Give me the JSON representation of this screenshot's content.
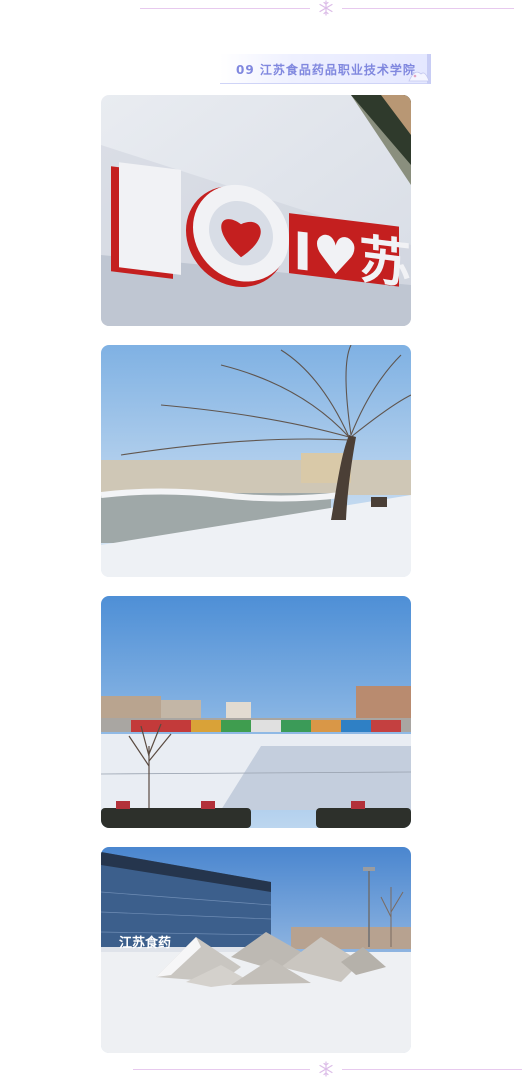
{
  "top_divider": {
    "icon": "snowflake-icon"
  },
  "section_label": {
    "text": "09 江苏食品药品职业技术学院",
    "decoration": "snow-landscape-icon",
    "accent_color": "#8088df"
  },
  "photos": [
    {
      "name": "photo-i-love-sign",
      "sign_text": "I♥苏食院"
    },
    {
      "name": "photo-willow-lake"
    },
    {
      "name": "photo-sports-field"
    },
    {
      "name": "photo-rock-garden",
      "sign_text": "江苏食药"
    }
  ],
  "bottom_divider": {
    "icon": "snowflake-icon"
  }
}
